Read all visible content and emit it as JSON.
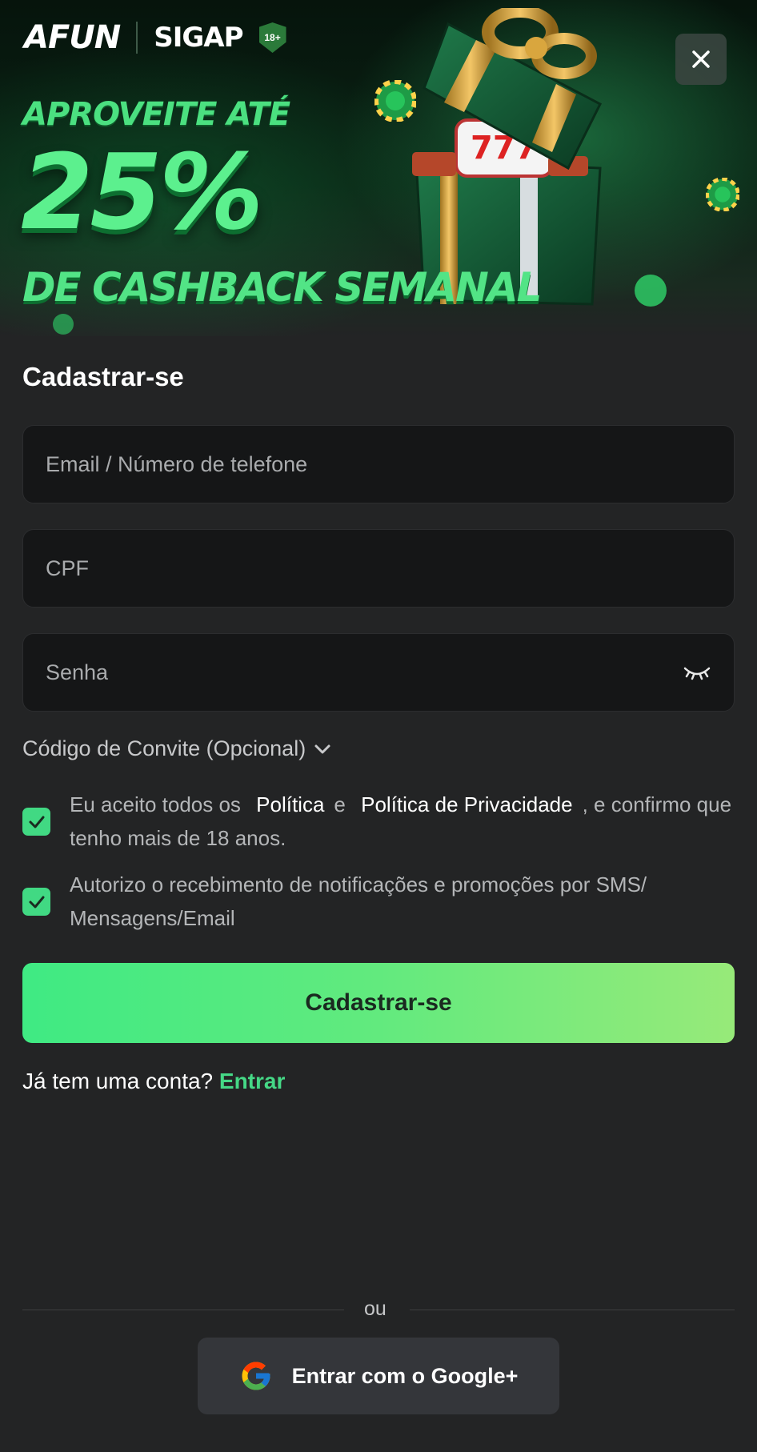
{
  "header": {
    "brand_logo": "AFUN",
    "partner_logo": "SIGAP",
    "age_badge": "18+",
    "close_icon": "close-icon"
  },
  "banner": {
    "line1": "APROVEITE ATÉ",
    "big": "25%",
    "line3": "DE CASHBACK SEMANAL",
    "colors": {
      "accent": "#52e486",
      "dark": "#06140c"
    }
  },
  "form": {
    "title": "Cadastrar-se",
    "fields": {
      "email_placeholder": "Email / Número de telefone",
      "cpf_placeholder": "CPF",
      "password_placeholder": "Senha"
    },
    "password_toggle_icon": "eye-closed-icon",
    "invite_label": "Código de Convite (Opcional)",
    "terms": {
      "prefix": "Eu aceito todos os",
      "link1": "Política",
      "middle": "e",
      "link2": "Política de Privacidade",
      "suffix": ", e confirmo que tenho mais de 18 anos.",
      "checked": true
    },
    "marketing": {
      "text": "Autorizo o recebimento de notificações e promoções por SMS/ Mensagens/Email",
      "checked": true
    },
    "submit_label": "Cadastrar-se",
    "login_prompt": "Já tem uma conta?",
    "login_link": "Entrar",
    "or_label": "ou",
    "google_label": "Entrar com o Google+",
    "google_icon": "google-icon"
  },
  "colors": {
    "background": "#232425",
    "field_bg": "#151617",
    "accent_green": "#41d983"
  }
}
